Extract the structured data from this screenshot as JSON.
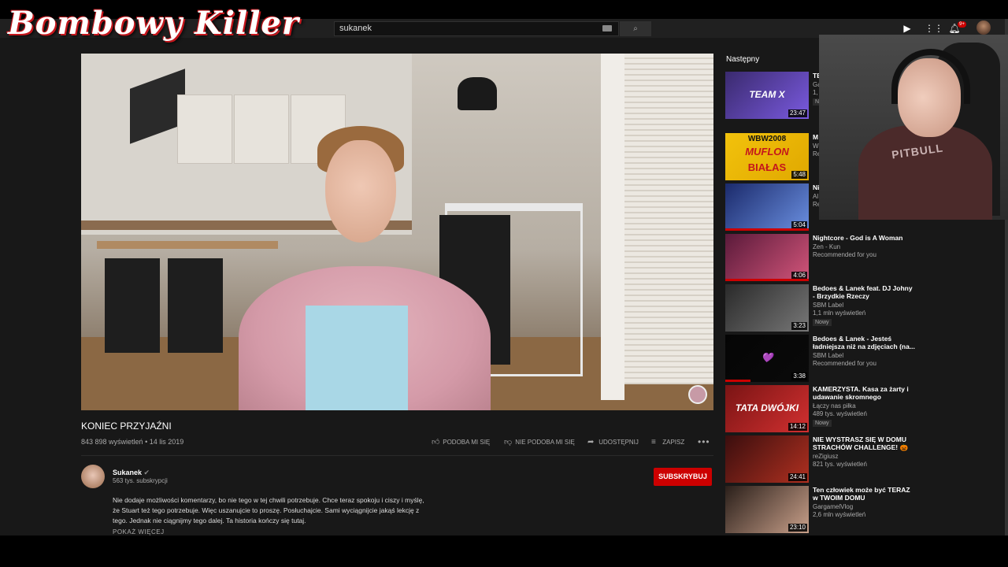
{
  "overlay": {
    "logo_text": "Bombowy Killer",
    "webcam_shirt_text": "PITBULL"
  },
  "header": {
    "search_value": "sukanek",
    "notification_count": "9+",
    "icons": [
      "keyboard-icon",
      "search-icon",
      "create-video-icon",
      "apps-grid-icon",
      "bell-icon"
    ]
  },
  "video": {
    "title": "KONIEC PRZYJAŹNI",
    "views": "843 898 wyświetleń",
    "date": "14 lis 2019",
    "like_label": "PODOBA MI SIĘ",
    "dislike_label": "NIE PODOBA MI SIĘ",
    "share_label": "UDOSTĘPNIJ",
    "save_label": "ZAPISZ",
    "more": "•••"
  },
  "channel": {
    "name": "Sukanek",
    "verified": "✔",
    "subscribers": "563 tys. subskrypcji",
    "subscribe_label": "SUBSKRYBUJ"
  },
  "description": {
    "text": "Nie dodaje możliwości komentarzy, bo nie tego w tej chwili potrzebuje. Chce teraz spokoju i ciszy i myślę, że Stuart też tego potrzebuje. Więc uszanujcie to proszę. Posłuchajcie. Sami wyciągnijcie jakąś lekcję z tego. Jednak nie ciągnijmy tego dalej. Ta historia kończy się tutaj.",
    "show_more": "POKAŻ WIĘCEJ"
  },
  "sidebar": {
    "next_label": "Następny",
    "items": [
      {
        "title": "TE",
        "channel": "Ga",
        "meta": "1,",
        "new": "N",
        "duration": "23:47",
        "thumb_text": "TEAM X",
        "colors": [
          "#3a2a6e",
          "#7a5adf"
        ],
        "progress": 0
      },
      {
        "title": "M 20",
        "channel": "W",
        "meta": "Re",
        "new": "",
        "duration": "5:48",
        "thumb_text": "MUFLON",
        "thumb_text2": "BIAŁAS",
        "thumb_top": "WBW2008",
        "colors": [
          "#f2c20c",
          "#e0a800"
        ],
        "progress": 0
      },
      {
        "title": "Ni",
        "channel": "Al",
        "meta": "Re",
        "new": "",
        "duration": "5:04",
        "thumb_text": "",
        "colors": [
          "#1b2a6b",
          "#6a8fe0"
        ],
        "progress": 1
      },
      {
        "title": "Nightcore - God is A Woman",
        "channel": "Zen - Kun",
        "meta": "Recommended for you",
        "new": "",
        "duration": "4:06",
        "thumb_text": "",
        "colors": [
          "#5a1a3a",
          "#d2557a"
        ],
        "progress": 1
      },
      {
        "title": "Bedoes & Lanek feat. DJ Johny - Brzydkie Rzeczy",
        "channel": "SBM Label",
        "meta": "1,1 mln wyświetleń",
        "new": "Nowy",
        "duration": "3:23",
        "thumb_text": "",
        "colors": [
          "#2a2a2a",
          "#777"
        ],
        "progress": 0
      },
      {
        "title": "Bedoes & Lanek - Jesteś ładniejsza niż na zdjęciach (na...",
        "channel": "SBM Label",
        "meta": "Recommended for you",
        "new": "",
        "duration": "3:38",
        "thumb_text": "💜",
        "colors": [
          "#050505",
          "#0a0a0a"
        ],
        "progress": 0.3
      },
      {
        "title": "KAMERZYSTA. Kasa za żarty i udawanie skromnego",
        "channel": "Łączy nas piłka",
        "meta": "489 tys. wyświetleń",
        "new": "Nowy",
        "duration": "14:12",
        "thumb_text": "TATA DWÓJKI",
        "colors": [
          "#7a1414",
          "#d23030"
        ],
        "progress": 0
      },
      {
        "title": "NIE WYSTRASZ SIĘ W DOMU STRACHÓW CHALLENGE! 🎃",
        "channel": "reZigiusz",
        "meta": "821 tys. wyświetleń",
        "new": "",
        "duration": "24:41",
        "thumb_text": "",
        "colors": [
          "#3a0e0e",
          "#b03020"
        ],
        "progress": 0
      },
      {
        "title": "Ten człowiek może być TERAZ w TWOIM DOMU",
        "channel": "GargamelVlog",
        "meta": "2,6 mln wyświetleń",
        "new": "",
        "duration": "23:10",
        "thumb_text": "",
        "colors": [
          "#2a1f1a",
          "#c9a08a"
        ],
        "progress": 0
      }
    ]
  }
}
